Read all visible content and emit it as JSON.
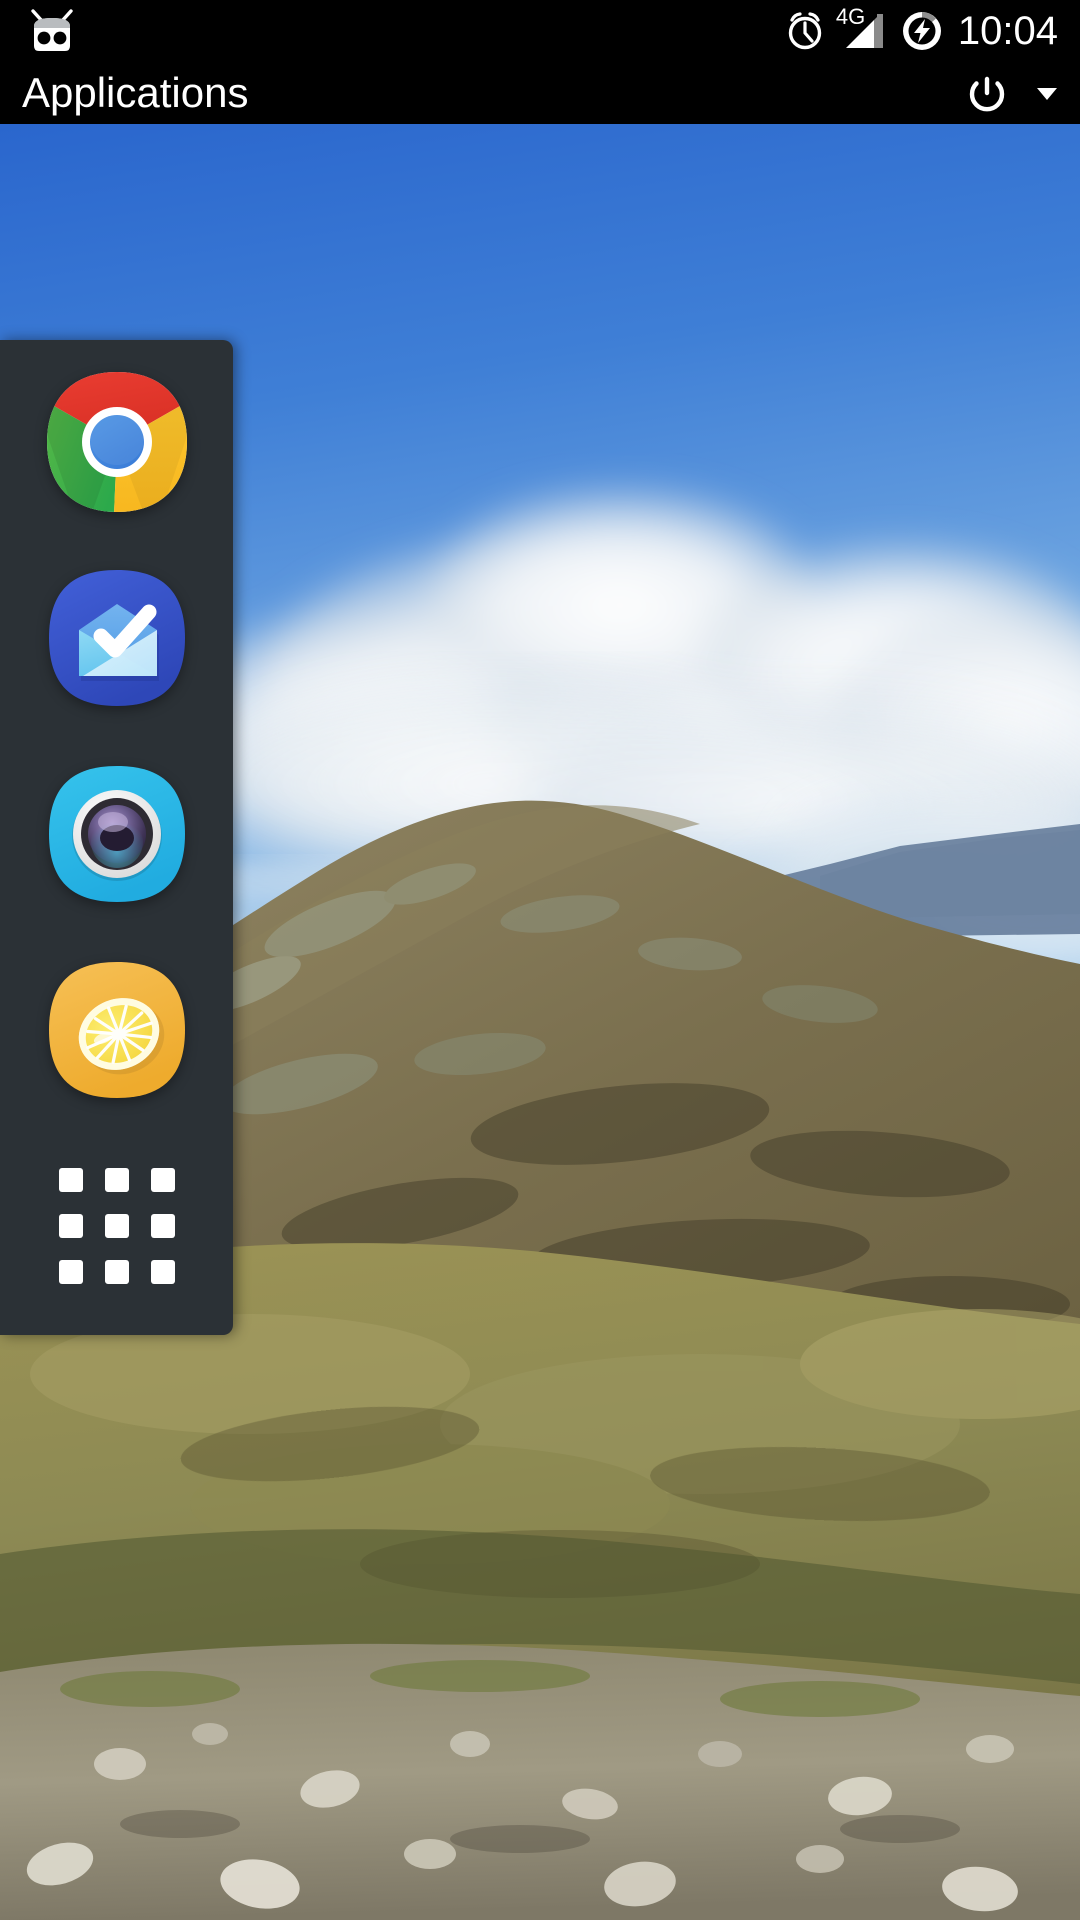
{
  "status_bar": {
    "logo_name": "cyanogenmod-logo",
    "icons": [
      {
        "name": "alarm-clock-icon",
        "label": "Alarm set"
      },
      {
        "name": "signal-4g-icon",
        "label": "4G"
      },
      {
        "name": "battery-charging-icon",
        "label": "Charging"
      }
    ],
    "network_label": "4G",
    "clock": "10:04"
  },
  "action_bar": {
    "title": "Applications",
    "power_label": "Power",
    "overflow_label": "More options"
  },
  "dock": {
    "background_color": "#2b3136",
    "apps": [
      {
        "name": "chrome",
        "label": "Chrome",
        "color": "#dd4b39"
      },
      {
        "name": "inbox",
        "label": "Inbox",
        "color": "#3b5ccc"
      },
      {
        "name": "camera",
        "label": "Camera",
        "color": "#2fb8e0"
      },
      {
        "name": "lemon",
        "label": "Lemon",
        "color": "#f4b942"
      }
    ],
    "drawer_label": "All apps"
  },
  "wallpaper": {
    "description": "Mountain hillside under blue sky with clouds",
    "sky_top_color": "#2f6fd0",
    "sky_bottom_color": "#8fc2e8",
    "cloud_color": "#e8edf2",
    "hill_color": "#7c7150",
    "foreground_color": "#9d9461"
  }
}
